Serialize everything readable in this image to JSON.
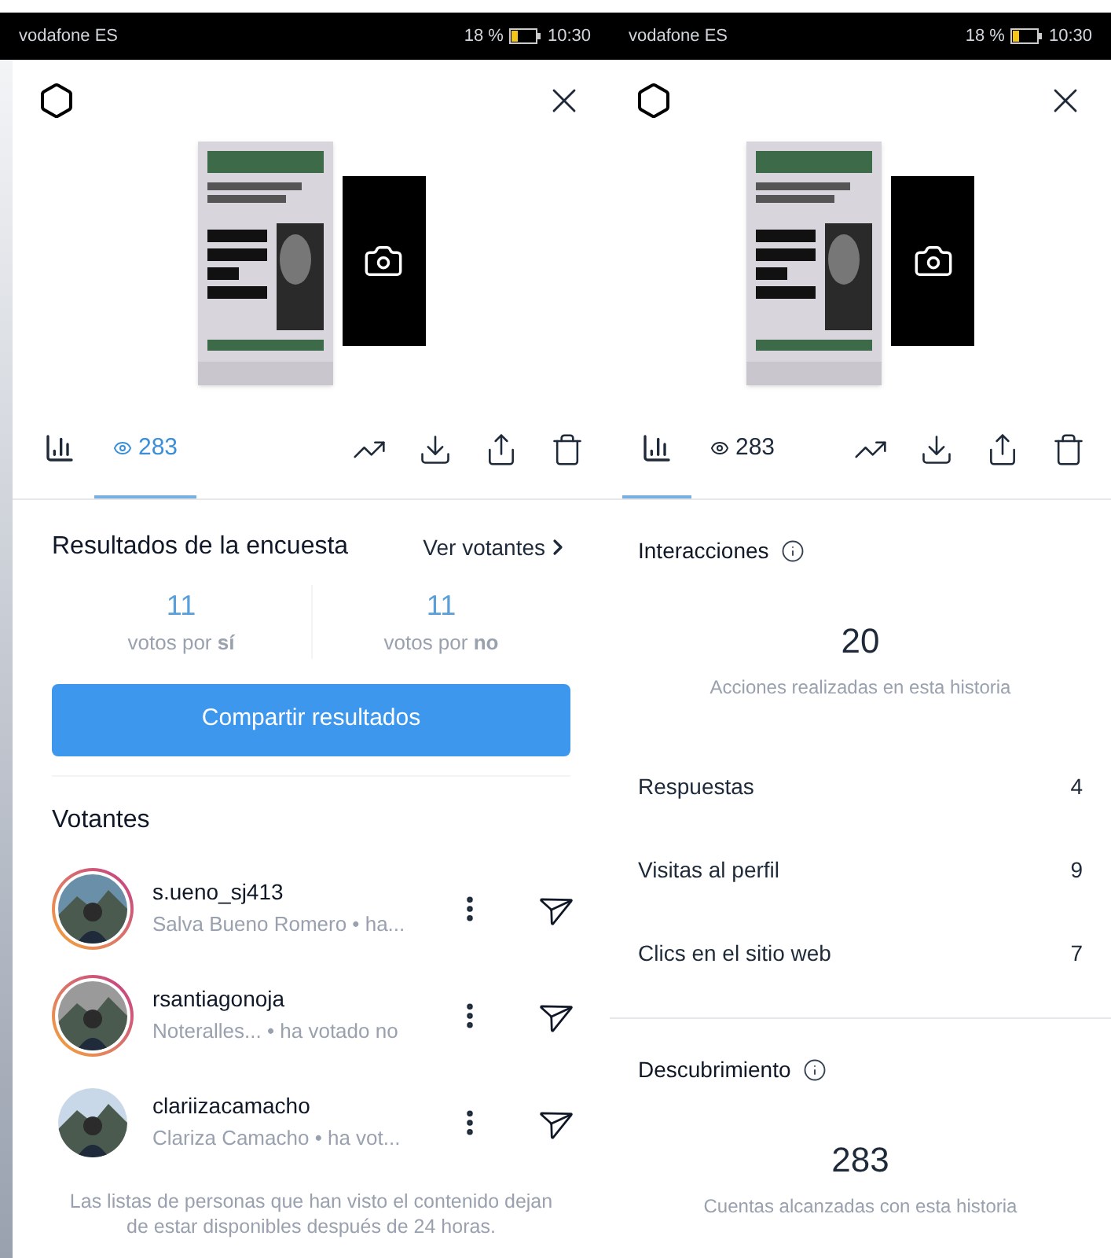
{
  "screens": [
    {
      "kind": "poll",
      "status_bar": {
        "carrier": "vodafone ES",
        "battery": "18 %",
        "time": "10:30"
      },
      "tabs": [
        {
          "kind": "chart",
          "selected": false
        },
        {
          "kind": "views",
          "label": "283",
          "selected": true
        }
      ],
      "poll": {
        "title": "Resultados de la encuesta",
        "link": "Ver votantes",
        "results": [
          {
            "count": "11",
            "label": "votos por **sí**"
          },
          {
            "count": "11",
            "label": "votos por **no**"
          }
        ],
        "button": "Compartir resultados",
        "voters_title": "Votantes",
        "voters": [
          {
            "username": "s.ueno_sj413",
            "subtitle": "Salva Bueno Romero • ha...",
            "story_ring": true
          },
          {
            "username": "rsantiagonoja",
            "subtitle": "Noteralles... • ha votado no",
            "story_ring": true
          },
          {
            "username": "clariizacamacho",
            "subtitle": "Clariza Camacho • ha vot...",
            "story_ring": false
          }
        ],
        "footer": "Las listas de personas que han visto el contenido dejan de estar disponibles después de 24 horas."
      }
    },
    {
      "kind": "insights",
      "status_bar": {
        "carrier": "vodafone ES",
        "battery": "18 %",
        "time": "10:30"
      },
      "tabs": [
        {
          "kind": "chart",
          "selected": true
        },
        {
          "kind": "views",
          "label": "283",
          "selected": false
        }
      ],
      "insights": {
        "sections": [
          {
            "title": "Interacciones",
            "total": "20",
            "caption": "Acciones realizadas en esta historia",
            "rows": [
              {
                "label": "Respuestas",
                "value": "4"
              },
              {
                "label": "Visitas al perfil",
                "value": "9"
              },
              {
                "label": "Clics en el sitio web",
                "value": "7"
              }
            ]
          },
          {
            "title": "Descubrimiento",
            "total": "283",
            "caption": "Cuentas alcanzadas con esta historia"
          }
        ]
      }
    }
  ]
}
